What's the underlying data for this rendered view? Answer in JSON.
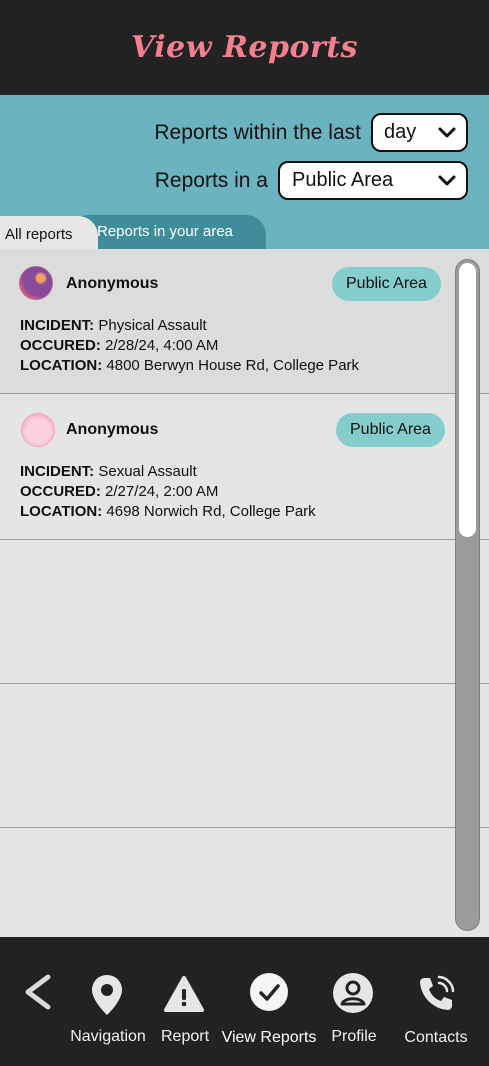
{
  "header": {
    "title": "View Reports"
  },
  "filters": {
    "timeframe_label": "Reports within the last",
    "timeframe_value": "day",
    "location_label": "Reports in a",
    "location_value": "Public Area"
  },
  "tabs": [
    {
      "label": "All reports",
      "active": true
    },
    {
      "label": "Reports in your area",
      "active": false
    }
  ],
  "reports": [
    {
      "name": "Anonymous",
      "badge": "Public Area",
      "incident_label": "INCIDENT:",
      "incident": "Physical Assault",
      "occured_label": "OCCURED:",
      "occured": "2/28/24, 4:00 AM",
      "location_label": "LOCATION:",
      "location": "4800 Berwyn House Rd, College Park"
    },
    {
      "name": "Anonymous",
      "badge": "Public Area",
      "incident_label": "INCIDENT:",
      "incident": "Sexual Assault",
      "occured_label": "OCCURED:",
      "occured": "2/27/24, 2:00 AM",
      "location_label": "LOCATION:",
      "location": "4698 Norwich Rd, College Park"
    }
  ],
  "nav": [
    {
      "label": "",
      "icon": "back-chevron-icon"
    },
    {
      "label": "Navigation",
      "icon": "map-pin-icon"
    },
    {
      "label": "Report",
      "icon": "warning-icon"
    },
    {
      "label": "View Reports",
      "icon": "check-circle-icon",
      "active": true
    },
    {
      "label": "Profile",
      "icon": "user-icon"
    },
    {
      "label": "Contacts",
      "icon": "phone-icon"
    }
  ],
  "colors": {
    "title": "#f47f8f",
    "filter_bg": "#6cb3c1",
    "tab_inactive": "#3f8d9b",
    "badge": "#85cccc",
    "nav_bg": "#222222"
  }
}
